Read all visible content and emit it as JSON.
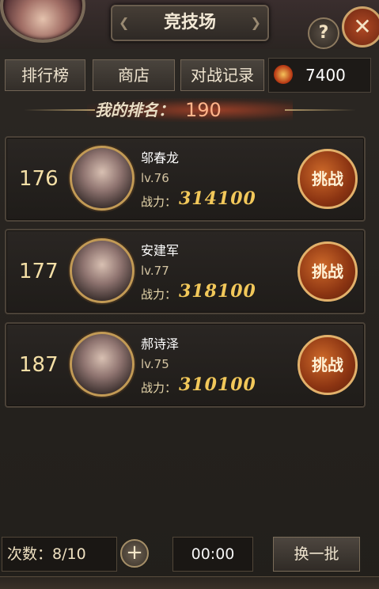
{
  "header": {
    "title": "竞技场",
    "help_label": "?",
    "close_label": "✕"
  },
  "nav": {
    "leaderboard_label": "排行榜",
    "shop_label": "商店",
    "battle_log_label": "对战记录",
    "currency_icon": "gold-medal-icon",
    "currency_value": "7400"
  },
  "my_rank": {
    "label": "我的排名：",
    "value": "190"
  },
  "opponents": [
    {
      "rank": "176",
      "name": "邬春龙",
      "level": "lv.76",
      "power_label": "战力：",
      "power": "314100",
      "challenge_label": "挑战"
    },
    {
      "rank": "177",
      "name": "安建军",
      "level": "lv.77",
      "power_label": "战力：",
      "power": "318100",
      "challenge_label": "挑战"
    },
    {
      "rank": "187",
      "name": "郝诗泽",
      "level": "lv.75",
      "power_label": "战力：",
      "power": "310100",
      "challenge_label": "挑战"
    }
  ],
  "footer": {
    "attempts_label": "次数：8/10",
    "add_label": "+",
    "timer": "00:00",
    "refresh_label": "换一批"
  },
  "colors": {
    "accent_orange": "#b14a25",
    "gold_text": "#f2c85a",
    "rank_highlight": "#ffb48a"
  }
}
